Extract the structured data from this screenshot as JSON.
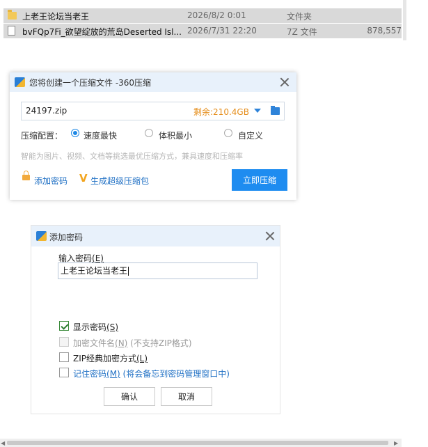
{
  "files": [
    {
      "icon": "folder-icon",
      "name": "上老王论坛当老王",
      "date": "2026/8/2 0:01",
      "type": "文件夹",
      "size": ""
    },
    {
      "icon": "document-icon",
      "name": "bvFQp7Fi_欲望绽放的荒岛Deserted Isl...",
      "date": "2026/7/31 22:20",
      "type": "7Z 文件",
      "size": "878,557"
    }
  ],
  "compress_dialog": {
    "title": "您将创建一个压缩文件 -360压缩",
    "filename": "24197.zip",
    "free_space": "剩余:210.4GB",
    "config_label": "压缩配置：",
    "options": [
      {
        "label": "速度最快",
        "selected": true
      },
      {
        "label": "体积最小",
        "selected": false
      },
      {
        "label": "自定义",
        "selected": false
      }
    ],
    "hint": "智能为图片、视频、文档等挑选最优压缩方式，兼具速度和压缩率",
    "add_password": "添加密码",
    "super_package": "生成超级压缩包",
    "compress_now": "立即压缩"
  },
  "password_dialog": {
    "title": "添加密码",
    "field_label": "输入密码",
    "field_key": "(E)",
    "password_value": "上老王论坛当老王",
    "checkboxes": [
      {
        "label": "显示密码",
        "key": "(S)",
        "note": "",
        "checked": true,
        "disabled": false
      },
      {
        "label": "加密文件名",
        "key": "(N)",
        "note": " (不支持ZIP格式)",
        "checked": false,
        "disabled": true
      },
      {
        "label": "ZIP经典加密方式",
        "key": "(L)",
        "note": "",
        "checked": false,
        "disabled": false
      },
      {
        "label": "记住密码",
        "key": "(M)",
        "note": " (将会备忘到密码管理窗口中)",
        "checked": false,
        "disabled": false
      }
    ],
    "ok": "确认",
    "cancel": "取消"
  },
  "colors": {
    "accent": "#1e8cf0",
    "free_space": "#e58d1a",
    "link": "#1e6fc4",
    "selection_row": "#d9d9d9"
  }
}
